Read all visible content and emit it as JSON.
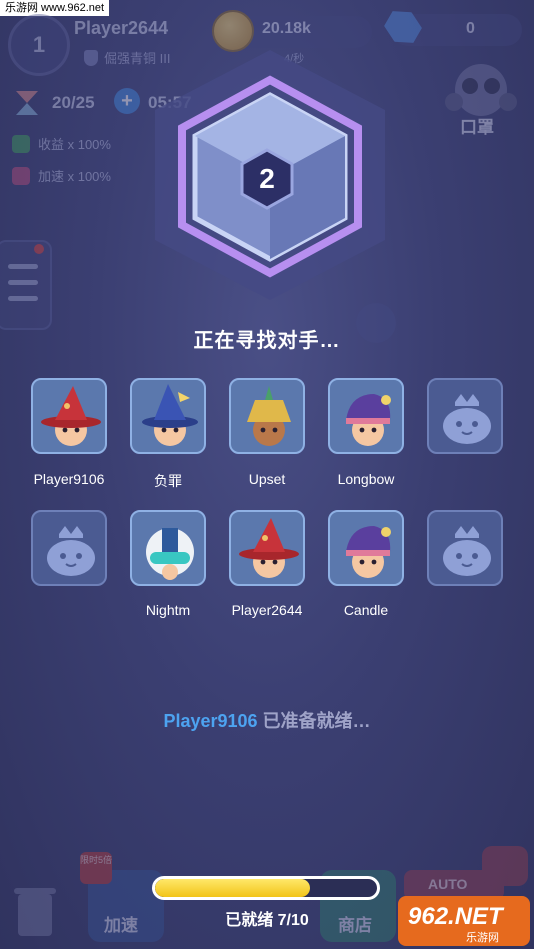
{
  "watermark": {
    "site": "乐游网 www.962.net",
    "logo_number": "962",
    "logo_net": ".NET",
    "logo_sub": "乐游网"
  },
  "hud": {
    "level": "1",
    "player_name": "Player2644",
    "rank": "倔强青铜 III",
    "coins": "20.18k",
    "coin_rate": "4/秒",
    "gems": "0",
    "energy": "20/25",
    "energy_plus": "+",
    "timer": "05:57",
    "buff_income": "收益 x 100%",
    "buff_speed": "加速 x 100%",
    "mask_label": "口罩"
  },
  "match": {
    "rank_number": "2",
    "status": "正在寻找对手…",
    "row1": [
      {
        "name": "Player9106",
        "avatar": "red-wizard"
      },
      {
        "name": "负罪",
        "avatar": "blue-wizard"
      },
      {
        "name": "Upset",
        "avatar": "pharaoh"
      },
      {
        "name": "Longbow",
        "avatar": "jester"
      },
      {
        "name": "",
        "avatar": "empty"
      }
    ],
    "row2": [
      {
        "name": "",
        "avatar": "empty"
      },
      {
        "name": "Nightm",
        "avatar": "helmet"
      },
      {
        "name": "Player2644",
        "avatar": "red-wizard"
      },
      {
        "name": "Candle",
        "avatar": "jester"
      },
      {
        "name": "",
        "avatar": "empty"
      }
    ],
    "ready_player": "Player9106",
    "ready_text": "已准备就绪…",
    "progress_label": "已就绪  7/10",
    "progress_fraction": 0.7
  },
  "bottom": {
    "speed_label": "加速",
    "speed_badge": "限时5倍",
    "shop_label": "商店",
    "auto_label": "AUTO"
  },
  "colors": {
    "ready_name": "#4da3f0",
    "progress": "#f2c418",
    "background": "#3b3f72"
  }
}
